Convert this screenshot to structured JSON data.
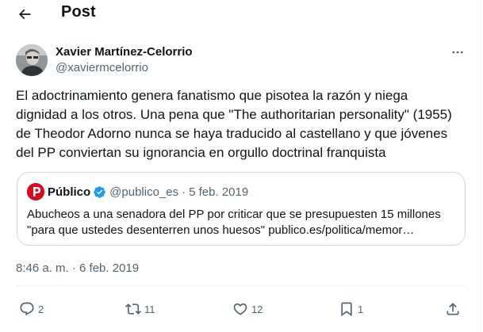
{
  "header": {
    "title": "Post"
  },
  "author": {
    "name": "Xavier Martínez-Celorrio",
    "handle": "@xaviermcelorrio"
  },
  "tweet": {
    "lines": [
      "El adoctrinamiento genera fanatismo que pisotea la razón y niega",
      "dignidad a los otros. Una pena que \"The authoritarian personality\" (1955)",
      "de Theodor Adorno nunca se haya traducido al castellano y que jóvenes",
      "del PP conviertan su ignorancia en orgullo doctrinal franquista"
    ]
  },
  "quote": {
    "name": "Público",
    "handle": "@publico_es",
    "separator": "·",
    "date": "5 feb. 2019",
    "lines": [
      "Abucheos a una senadora del PP por criticar que se presupuesten 15 millones",
      "\"para que ustedes desenterren unos huesos\"  publico.es/politica/memor…"
    ]
  },
  "timestamp": "8:46 a. m. · 6 feb. 2019",
  "actions": {
    "replies": "2",
    "reposts": "11",
    "likes": "12",
    "bookmarks": "1"
  },
  "colors": {
    "text": "#0f1419",
    "secondary": "#536471",
    "border": "#cfd9de",
    "verified": "#1d9bf0",
    "publico_red": "#d90c1f"
  }
}
